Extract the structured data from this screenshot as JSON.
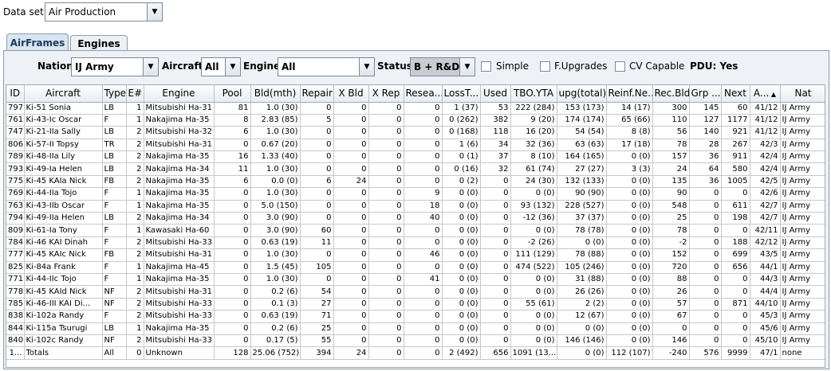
{
  "dataset": {
    "label": "Data set:",
    "value": "Air Production"
  },
  "tabs": [
    "AirFrames",
    "Engines"
  ],
  "filters": {
    "nation_label": "Nation:",
    "nation_value": "IJ Army",
    "aircraft_label": "Aircraft:",
    "aircraft_value": "All",
    "engine_label": "Engine:",
    "engine_value": "All",
    "status_label": "Status:",
    "status_value": "B + R&D",
    "simple_label": "Simple",
    "fupgrades_label": "F.Upgrades",
    "cvcapable_label": "CV Capable",
    "pdu_label": "PDU: Yes"
  },
  "table": {
    "sort_indicator": "▲",
    "columns": [
      "ID",
      "Aircraft",
      "Type",
      "E#",
      "Engine",
      "Pool",
      "Bld(mth)",
      "Repair",
      "X Bld",
      "X Rep",
      "Resea...",
      "LossT...",
      "Used",
      "TBO.YTA",
      "upg(total)",
      "Reinf.Ne...",
      "Rec.Bld",
      "Grp ...",
      "Next",
      "A...",
      "Nat"
    ],
    "rows": [
      [
        "797",
        "Ki-51 Sonia",
        "LB",
        "1",
        "Mitsubishi Ha-31",
        "81",
        "1.0 (30)",
        "0",
        "0",
        "0",
        "0",
        "1 (37)",
        "53",
        "222 (284)",
        "153 (173)",
        "14 (17)",
        "300",
        "145",
        "60",
        "41/12",
        "IJ Army"
      ],
      [
        "761",
        "Ki-43-Ic Oscar",
        "F",
        "1",
        "Nakajima Ha-35",
        "8",
        "2.83 (85)",
        "5",
        "0",
        "0",
        "0",
        "0 (262)",
        "382",
        "9 (20)",
        "174 (174)",
        "65 (66)",
        "110",
        "127",
        "1177",
        "41/12",
        "IJ Army"
      ],
      [
        "747",
        "Ki-21-IIa Sally",
        "LB",
        "2",
        "Mitsubishi Ha-32",
        "6",
        "1.0 (30)",
        "0",
        "0",
        "0",
        "0",
        "0 (168)",
        "118",
        "16 (20)",
        "54 (54)",
        "8 (8)",
        "56",
        "140",
        "921",
        "41/12",
        "IJ Army"
      ],
      [
        "806",
        "Ki-57-II Topsy",
        "TR",
        "2",
        "Mitsubishi Ha-31",
        "0",
        "0.67 (20)",
        "0",
        "0",
        "0",
        "0",
        "1 (6)",
        "34",
        "32 (36)",
        "63 (63)",
        "17 (18)",
        "78",
        "28",
        "267",
        "42/3",
        "IJ Army"
      ],
      [
        "789",
        "Ki-48-IIa Lily",
        "LB",
        "2",
        "Nakajima Ha-35",
        "16",
        "1.33 (40)",
        "0",
        "0",
        "0",
        "0",
        "0 (1)",
        "37",
        "8 (10)",
        "164 (165)",
        "0 (0)",
        "157",
        "36",
        "911",
        "42/4",
        "IJ Army"
      ],
      [
        "793",
        "Ki-49-Ia Helen",
        "LB",
        "2",
        "Nakajima Ha-34",
        "11",
        "1.0 (30)",
        "0",
        "0",
        "0",
        "0",
        "0 (16)",
        "32",
        "61 (74)",
        "27 (27)",
        "3 (3)",
        "24",
        "64",
        "580",
        "42/4",
        "IJ Army"
      ],
      [
        "775",
        "Ki-45 KAIa Nick",
        "FB",
        "2",
        "Nakajima Ha-35",
        "6",
        "0.0 (0)",
        "6",
        "24",
        "0",
        "0",
        "0 (2)",
        "0",
        "24 (30)",
        "132 (133)",
        "0 (0)",
        "135",
        "36",
        "1005",
        "42/5",
        "IJ Army"
      ],
      [
        "769",
        "Ki-44-IIa Tojo",
        "F",
        "1",
        "Nakajima Ha-35",
        "0",
        "1.0 (30)",
        "0",
        "0",
        "0",
        "9",
        "0 (0)",
        "0",
        "0 (0)",
        "90 (90)",
        "0 (0)",
        "90",
        "0",
        "0",
        "42/6",
        "IJ Army"
      ],
      [
        "763",
        "Ki-43-IIb Oscar",
        "F",
        "1",
        "Nakajima Ha-35",
        "0",
        "5.0 (150)",
        "0",
        "0",
        "0",
        "18",
        "0 (0)",
        "0",
        "93 (132)",
        "228 (527)",
        "0 (0)",
        "548",
        "0",
        "611",
        "42/7",
        "IJ Army"
      ],
      [
        "794",
        "Ki-49-IIa Helen",
        "LB",
        "2",
        "Nakajima Ha-34",
        "0",
        "3.0 (90)",
        "0",
        "0",
        "0",
        "40",
        "0 (0)",
        "0",
        "-12 (36)",
        "37 (37)",
        "0 (0)",
        "25",
        "0",
        "198",
        "42/7",
        "IJ Army"
      ],
      [
        "809",
        "Ki-61-Ia Tony",
        "F",
        "1",
        "Kawasaki Ha-60",
        "0",
        "3.0 (90)",
        "60",
        "0",
        "0",
        "0",
        "0 (0)",
        "0",
        "0 (0)",
        "78 (78)",
        "0 (0)",
        "78",
        "0",
        "0",
        "42/11",
        "IJ Army"
      ],
      [
        "784",
        "Ki-46 KAI Dinah",
        "F",
        "2",
        "Mitsubishi Ha-33",
        "0",
        "0.63 (19)",
        "11",
        "0",
        "0",
        "0",
        "0 (0)",
        "0",
        "-2 (26)",
        "0 (0)",
        "0 (0)",
        "-2",
        "0",
        "188",
        "42/12",
        "IJ Army"
      ],
      [
        "777",
        "Ki-45 KAIc Nick",
        "FB",
        "2",
        "Mitsubishi Ha-31",
        "0",
        "1.0 (30)",
        "0",
        "0",
        "0",
        "46",
        "0 (0)",
        "0",
        "111 (129)",
        "78 (88)",
        "0 (0)",
        "152",
        "0",
        "699",
        "43/5",
        "IJ Army"
      ],
      [
        "825",
        "Ki-84a Frank",
        "F",
        "1",
        "Nakajima Ha-45",
        "0",
        "1.5 (45)",
        "105",
        "0",
        "0",
        "0",
        "0 (0)",
        "0",
        "474 (522)",
        "105 (246)",
        "0 (0)",
        "720",
        "0",
        "656",
        "44/1",
        "IJ Army"
      ],
      [
        "771",
        "Ki-44-IIc Tojo",
        "F",
        "1",
        "Nakajima Ha-35",
        "0",
        "1.0 (30)",
        "0",
        "0",
        "0",
        "41",
        "0 (0)",
        "0",
        "0 (0)",
        "31 (88)",
        "0 (0)",
        "88",
        "0",
        "0",
        "44/3",
        "IJ Army"
      ],
      [
        "778",
        "Ki-45 KAId Nick",
        "NF",
        "2",
        "Mitsubishi Ha-31",
        "0",
        "0.2 (6)",
        "54",
        "0",
        "0",
        "0",
        "0 (0)",
        "0",
        "0 (0)",
        "26 (26)",
        "0 (0)",
        "26",
        "0",
        "0",
        "44/4",
        "IJ Army"
      ],
      [
        "785",
        "Ki-46-III KAI Di...",
        "NF",
        "2",
        "Mitsubishi Ha-33",
        "0",
        "0.1 (3)",
        "27",
        "0",
        "0",
        "0",
        "0 (0)",
        "0",
        "55 (61)",
        "2 (2)",
        "0 (0)",
        "57",
        "0",
        "871",
        "44/10",
        "IJ Army"
      ],
      [
        "838",
        "Ki-102a Randy",
        "F",
        "2",
        "Mitsubishi Ha-33",
        "0",
        "0.63 (19)",
        "71",
        "0",
        "0",
        "0",
        "0 (0)",
        "0",
        "0 (0)",
        "12 (67)",
        "0 (0)",
        "67",
        "0",
        "0",
        "45/3",
        "IJ Army"
      ],
      [
        "844",
        "Ki-115a Tsurugi",
        "LB",
        "1",
        "Nakajima Ha-35",
        "0",
        "0.2 (6)",
        "25",
        "0",
        "0",
        "0",
        "0 (0)",
        "0",
        "0 (0)",
        "0 (0)",
        "0 (0)",
        "0",
        "0",
        "0",
        "45/6",
        "IJ Army"
      ],
      [
        "840",
        "Ki-102c Randy",
        "NF",
        "2",
        "Mitsubishi Ha-33",
        "0",
        "0.17 (5)",
        "55",
        "0",
        "0",
        "0",
        "0 (0)",
        "0",
        "0 (0)",
        "146 (146)",
        "0 (0)",
        "146",
        "0",
        "0",
        "45/10",
        "IJ Army"
      ],
      [
        "1...",
        "Totals",
        "All",
        "0",
        "Unknown",
        "128",
        "25.06 (752)",
        "394",
        "24",
        "0",
        "0",
        "2 (492)",
        "656",
        "1091 (13...",
        "0 (0)",
        "112 (107)",
        "-240",
        "576",
        "9999",
        "47/1",
        "none"
      ]
    ]
  }
}
